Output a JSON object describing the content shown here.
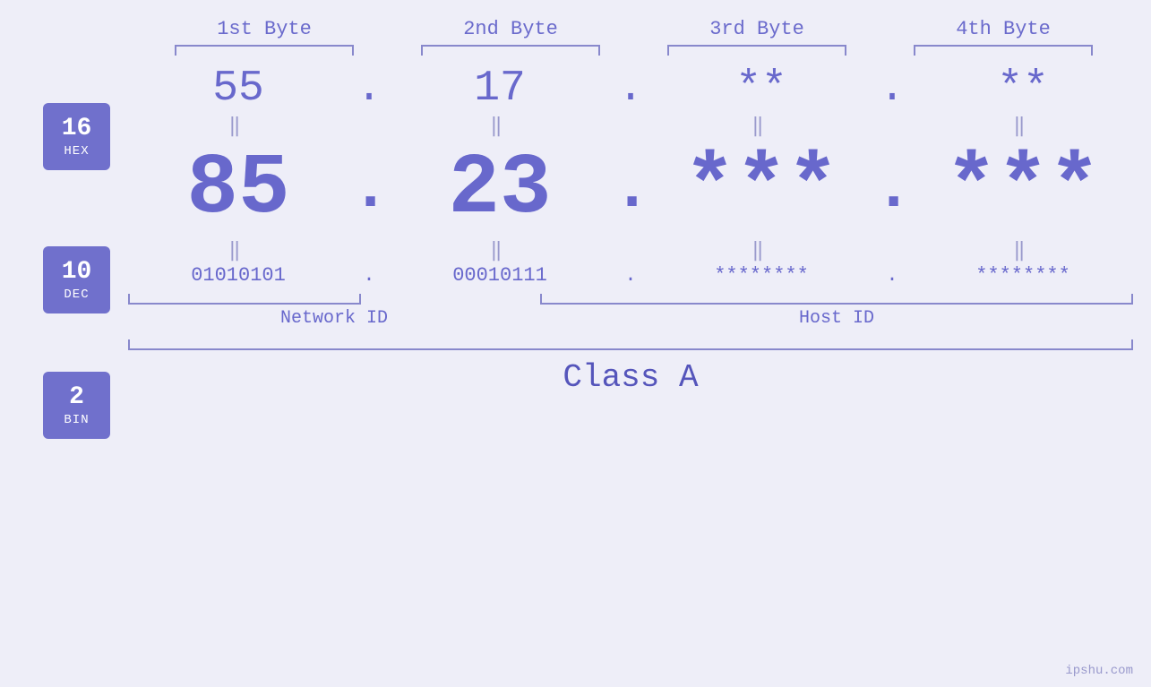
{
  "page": {
    "background": "#eeeef8",
    "watermark": "ipshu.com"
  },
  "byte_headers": [
    {
      "label": "1st Byte"
    },
    {
      "label": "2nd Byte"
    },
    {
      "label": "3rd Byte"
    },
    {
      "label": "4th Byte"
    }
  ],
  "bases": [
    {
      "number": "16",
      "label": "HEX"
    },
    {
      "number": "10",
      "label": "DEC"
    },
    {
      "number": "2",
      "label": "BIN"
    }
  ],
  "hex_row": {
    "values": [
      "55",
      "17",
      "**",
      "**"
    ],
    "dots": [
      ".",
      ".",
      "."
    ]
  },
  "dec_row": {
    "values": [
      "85",
      "23",
      "***",
      "***"
    ],
    "dots": [
      ".",
      ".",
      "."
    ]
  },
  "bin_row": {
    "values": [
      "01010101",
      "00010111",
      "********",
      "********"
    ],
    "dots": [
      ".",
      ".",
      "."
    ]
  },
  "network_id_label": "Network ID",
  "host_id_label": "Host ID",
  "class_label": "Class A"
}
